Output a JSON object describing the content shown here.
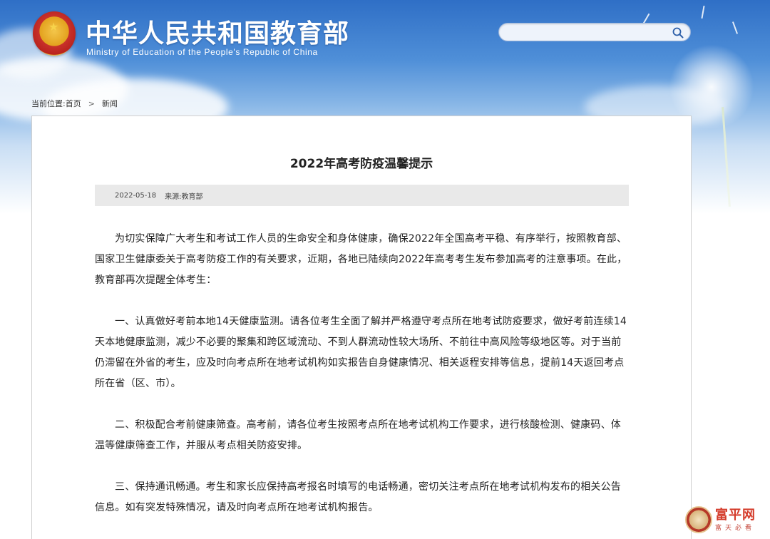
{
  "header": {
    "title": "中华人民共和国教育部",
    "subtitle": "Ministry of Education of the People's Republic of China"
  },
  "search": {
    "value": "",
    "placeholder": ""
  },
  "breadcrumb": {
    "label": "当前位置:",
    "home": "首页",
    "separator": ">",
    "current": "新闻"
  },
  "article": {
    "title": "2022年高考防疫温馨提示",
    "date": "2022-05-18",
    "source_label": "来源:",
    "source": "教育部",
    "paragraphs": [
      "为切实保障广大考生和考试工作人员的生命安全和身体健康，确保2022年全国高考平稳、有序举行，按照教育部、国家卫生健康委关于高考防疫工作的有关要求，近期，各地已陆续向2022年高考考生发布参加高考的注意事项。在此，教育部再次提醒全体考生：",
      "一、认真做好考前本地14天健康监测。请各位考生全面了解并严格遵守考点所在地考试防疫要求，做好考前连续14天本地健康监测，减少不必要的聚集和跨区域流动、不到人群流动性较大场所、不前往中高风险等级地区等。对于当前仍滞留在外省的考生，应及时向考点所在地考试机构如实报告自身健康情况、相关返程安排等信息，提前14天返回考点所在省（区、市）。",
      "二、积极配合考前健康筛查。高考前，请各位考生按照考点所在地考试机构工作要求，进行核酸检测、健康码、体温等健康筛查工作，并服从考点相关防疫安排。",
      "三、保持通讯畅通。考生和家长应保持高考报名时填写的电话畅通，密切关注考点所在地考试机构发布的相关公告信息。如有突发特殊情况，请及时向考点所在地考试机构报告。"
    ]
  },
  "watermark": {
    "main": "富平网",
    "sub": "富天必看"
  },
  "colors": {
    "sky_top": "#2f6fc6",
    "title_text": "#ffffff",
    "meta_bar": "#e9e9e9",
    "watermark_red": "#d43b2a"
  }
}
